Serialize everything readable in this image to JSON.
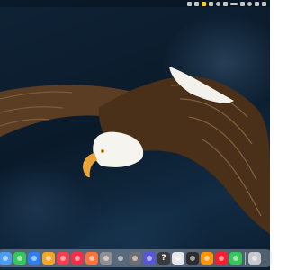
{
  "screen": {
    "wallpaper": "bald-eagle-in-flight",
    "background_color": "#0d2133"
  },
  "menubar": {
    "status_icons": [
      "app-icon",
      "app-icon",
      "app-icon",
      "app-icon",
      "wifi-icon",
      "app-icon",
      "battery-icon",
      "app-icon",
      "control-center-icon",
      "app-icon",
      "app-icon"
    ]
  },
  "dock": {
    "apps": [
      {
        "name": "finder",
        "icon": "finder-icon",
        "color": "#4a9cf0"
      },
      {
        "name": "messages",
        "icon": "messages-icon",
        "color": "#34c759"
      },
      {
        "name": "safari",
        "icon": "safari-icon",
        "color": "#2f7ff0"
      },
      {
        "name": "photos",
        "icon": "photos-icon",
        "color": "#f5a623"
      },
      {
        "name": "news",
        "icon": "news-icon",
        "color": "#ff3b4e"
      },
      {
        "name": "music",
        "icon": "music-icon",
        "color": "#fa2d48"
      },
      {
        "name": "firefox",
        "icon": "firefox-icon",
        "color": "#ff7139"
      },
      {
        "name": "system-settings",
        "icon": "gear-icon",
        "color": "#8e8e93"
      },
      {
        "name": "preview",
        "icon": "preview-icon",
        "color": "#5b6b7c"
      },
      {
        "name": "screenshot",
        "icon": "screenshot-icon",
        "color": "#6d6d72"
      },
      {
        "name": "app",
        "icon": "colorful-app-icon",
        "color": "#5856d6"
      },
      {
        "name": "help",
        "icon": "question-icon",
        "color": "#3a3a3c",
        "label": "?"
      },
      {
        "name": "disk-utility",
        "icon": "disk-icon",
        "color": "#e5e5ea"
      },
      {
        "name": "activity-monitor",
        "icon": "gauge-icon",
        "color": "#2c2c2e"
      },
      {
        "name": "app-store",
        "icon": "app-store-icon",
        "color": "#ff9500"
      },
      {
        "name": "opera",
        "icon": "opera-icon",
        "color": "#ff1b2d"
      },
      {
        "name": "app",
        "icon": "app-icon",
        "color": "#34c759"
      },
      {
        "name": "trash",
        "icon": "trash-icon",
        "color": "#c7c7cc"
      }
    ]
  }
}
